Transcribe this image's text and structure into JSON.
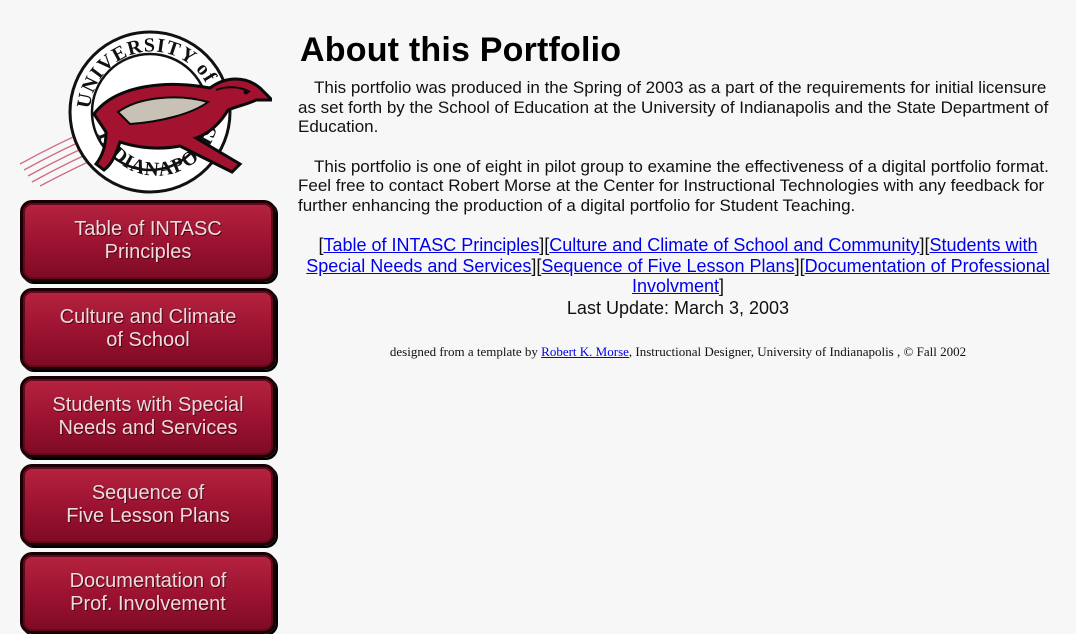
{
  "logo": {
    "top_text": "UNIVERSITY of",
    "bottom_text": "INDIANAPOLIS",
    "colors": {
      "crimson": "#a3122f",
      "grey": "#c7c1b6",
      "black": "#0a0a0a"
    }
  },
  "nav": {
    "items": [
      {
        "label": "Table of INTASC\nPrinciples"
      },
      {
        "label": "Culture and Climate\nof School"
      },
      {
        "label": "Students with Special\nNeeds and Services"
      },
      {
        "label": "Sequence of\nFive Lesson Plans"
      },
      {
        "label": "Documentation of\nProf. Involvement"
      }
    ]
  },
  "main": {
    "title": "About this Portfolio",
    "paragraph1": "This portfolio was produced in the Spring of 2003 as a part of the requirements for initial licensure as set forth by the School of Education at the University of Indianapolis and the State Department of Education.",
    "paragraph2": "This portfolio is one of eight in pilot group to examine the effectiveness of a digital portfolio format. Feel free to contact Robert Morse at the Center for Instructional Technologies with any feedback for further enhancing the production of a digital portfolio for Student Teaching.",
    "links": [
      "Table of INTASC Principles",
      "Culture and Climate of School and Community",
      "Students with Special Needs and Services",
      "Sequence of Five Lesson Plans",
      "Documentation of Professional Involvment"
    ],
    "last_update": "Last Update: March 3, 2003",
    "credit": {
      "prefix": "designed from a template by",
      "link": "Robert K. Morse",
      "suffix": ", Instructional Designer, University of Indianapolis , © Fall 2002"
    }
  },
  "link_color": "#0000ee"
}
